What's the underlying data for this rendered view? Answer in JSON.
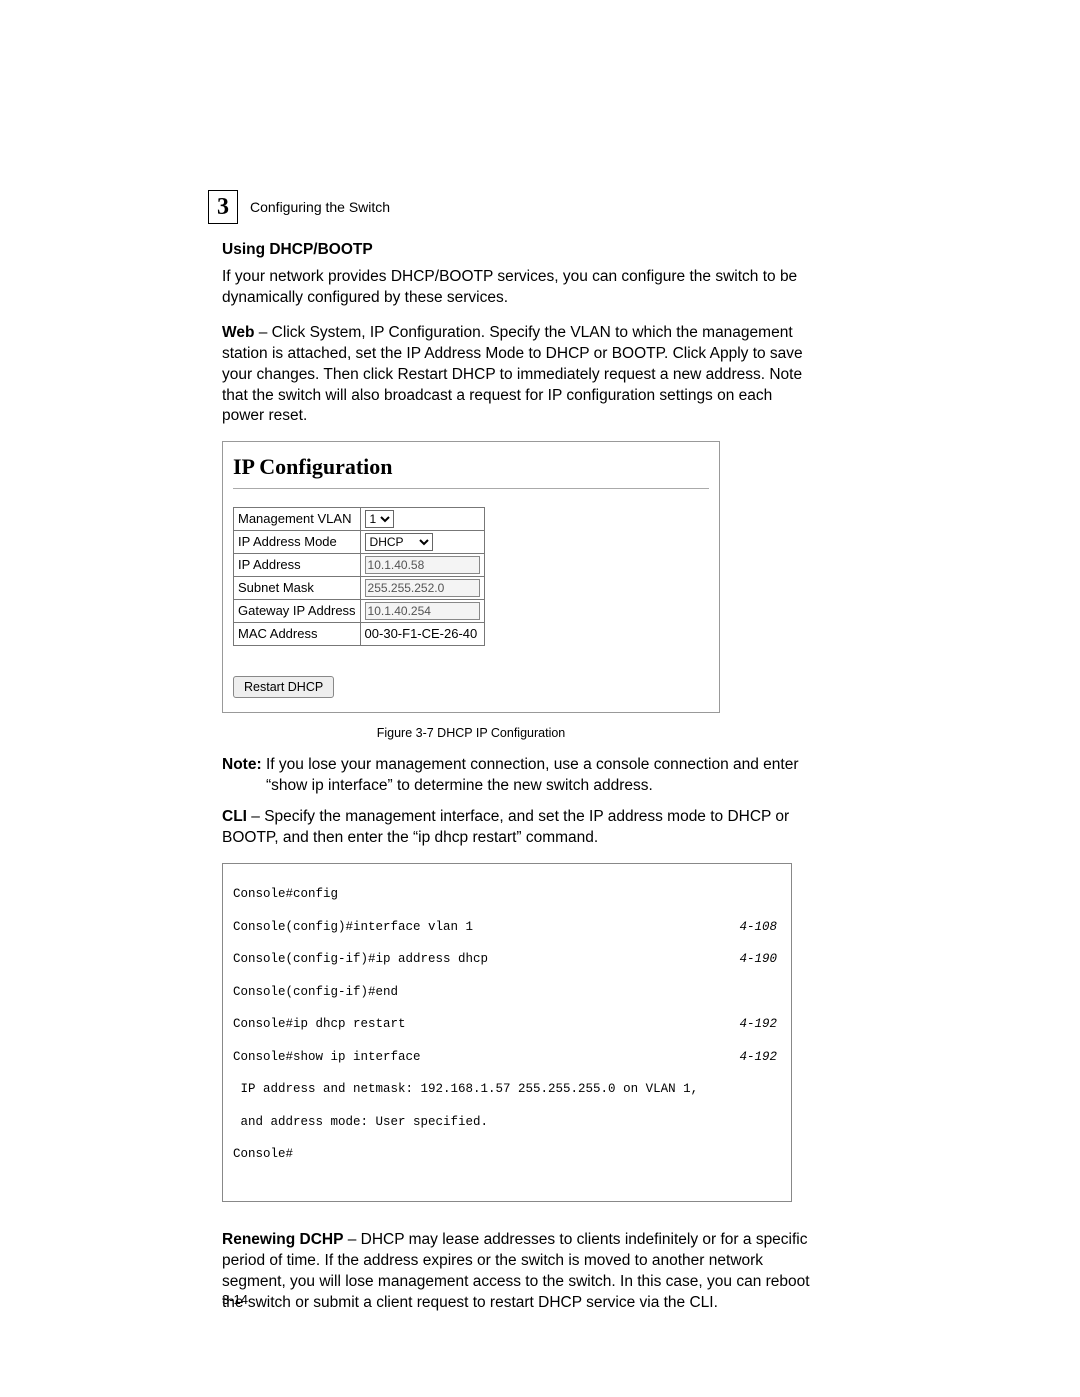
{
  "header": {
    "chapter_number": "3",
    "chapter_title": "Configuring the Switch"
  },
  "section": {
    "subheading": "Using DHCP/BOOTP",
    "intro": "If your network provides DHCP/BOOTP services, you can configure the switch to be dynamically configured by these services.",
    "web_label": "Web",
    "web_text": " – Click System, IP Configuration. Specify the VLAN to which the management station is attached, set the IP Address Mode to DHCP or BOOTP. Click Apply to save your changes. Then click Restart DHCP to immediately request a new address. Note that the switch will also broadcast a request for IP configuration settings on each power reset."
  },
  "figure": {
    "title": "IP Configuration",
    "rows": {
      "mgmt_vlan_label": "Management VLAN",
      "mgmt_vlan_value": "1",
      "mode_label": "IP Address Mode",
      "mode_value": "DHCP",
      "ip_label": "IP Address",
      "ip_value": "10.1.40.58",
      "mask_label": "Subnet Mask",
      "mask_value": "255.255.252.0",
      "gw_label": "Gateway IP Address",
      "gw_value": "10.1.40.254",
      "mac_label": "MAC Address",
      "mac_value": "00-30-F1-CE-26-40"
    },
    "button": "Restart DHCP",
    "caption": "Figure 3-7  DHCP IP Configuration"
  },
  "note": {
    "label": "Note:",
    "text": "If you lose your management connection, use a console connection and enter “show ip interface” to determine the new switch address."
  },
  "cli": {
    "label": "CLI",
    "text": " – Specify the management interface, and set the IP address mode to DHCP or BOOTP, and then enter the “ip dhcp restart” command.",
    "lines": [
      {
        "cmd": "Console#config",
        "ref": ""
      },
      {
        "cmd": "Console(config)#interface vlan 1",
        "ref": "4-108"
      },
      {
        "cmd": "Console(config-if)#ip address dhcp",
        "ref": "4-190"
      },
      {
        "cmd": "Console(config-if)#end",
        "ref": ""
      },
      {
        "cmd": "Console#ip dhcp restart",
        "ref": "4-192"
      },
      {
        "cmd": "Console#show ip interface",
        "ref": "4-192"
      },
      {
        "cmd": " IP address and netmask: 192.168.1.57 255.255.255.0 on VLAN 1,",
        "ref": ""
      },
      {
        "cmd": " and address mode: User specified.",
        "ref": ""
      },
      {
        "cmd": "Console#",
        "ref": ""
      }
    ]
  },
  "renew": {
    "label": "Renewing DCHP",
    "text": " – DHCP may lease addresses to clients indefinitely or for a specific period of time. If the address expires or the switch is moved to another network segment, you will lose management access to the switch. In this case, you can reboot the switch or submit a client request to restart DHCP service via the CLI."
  },
  "page_number": "3-14"
}
